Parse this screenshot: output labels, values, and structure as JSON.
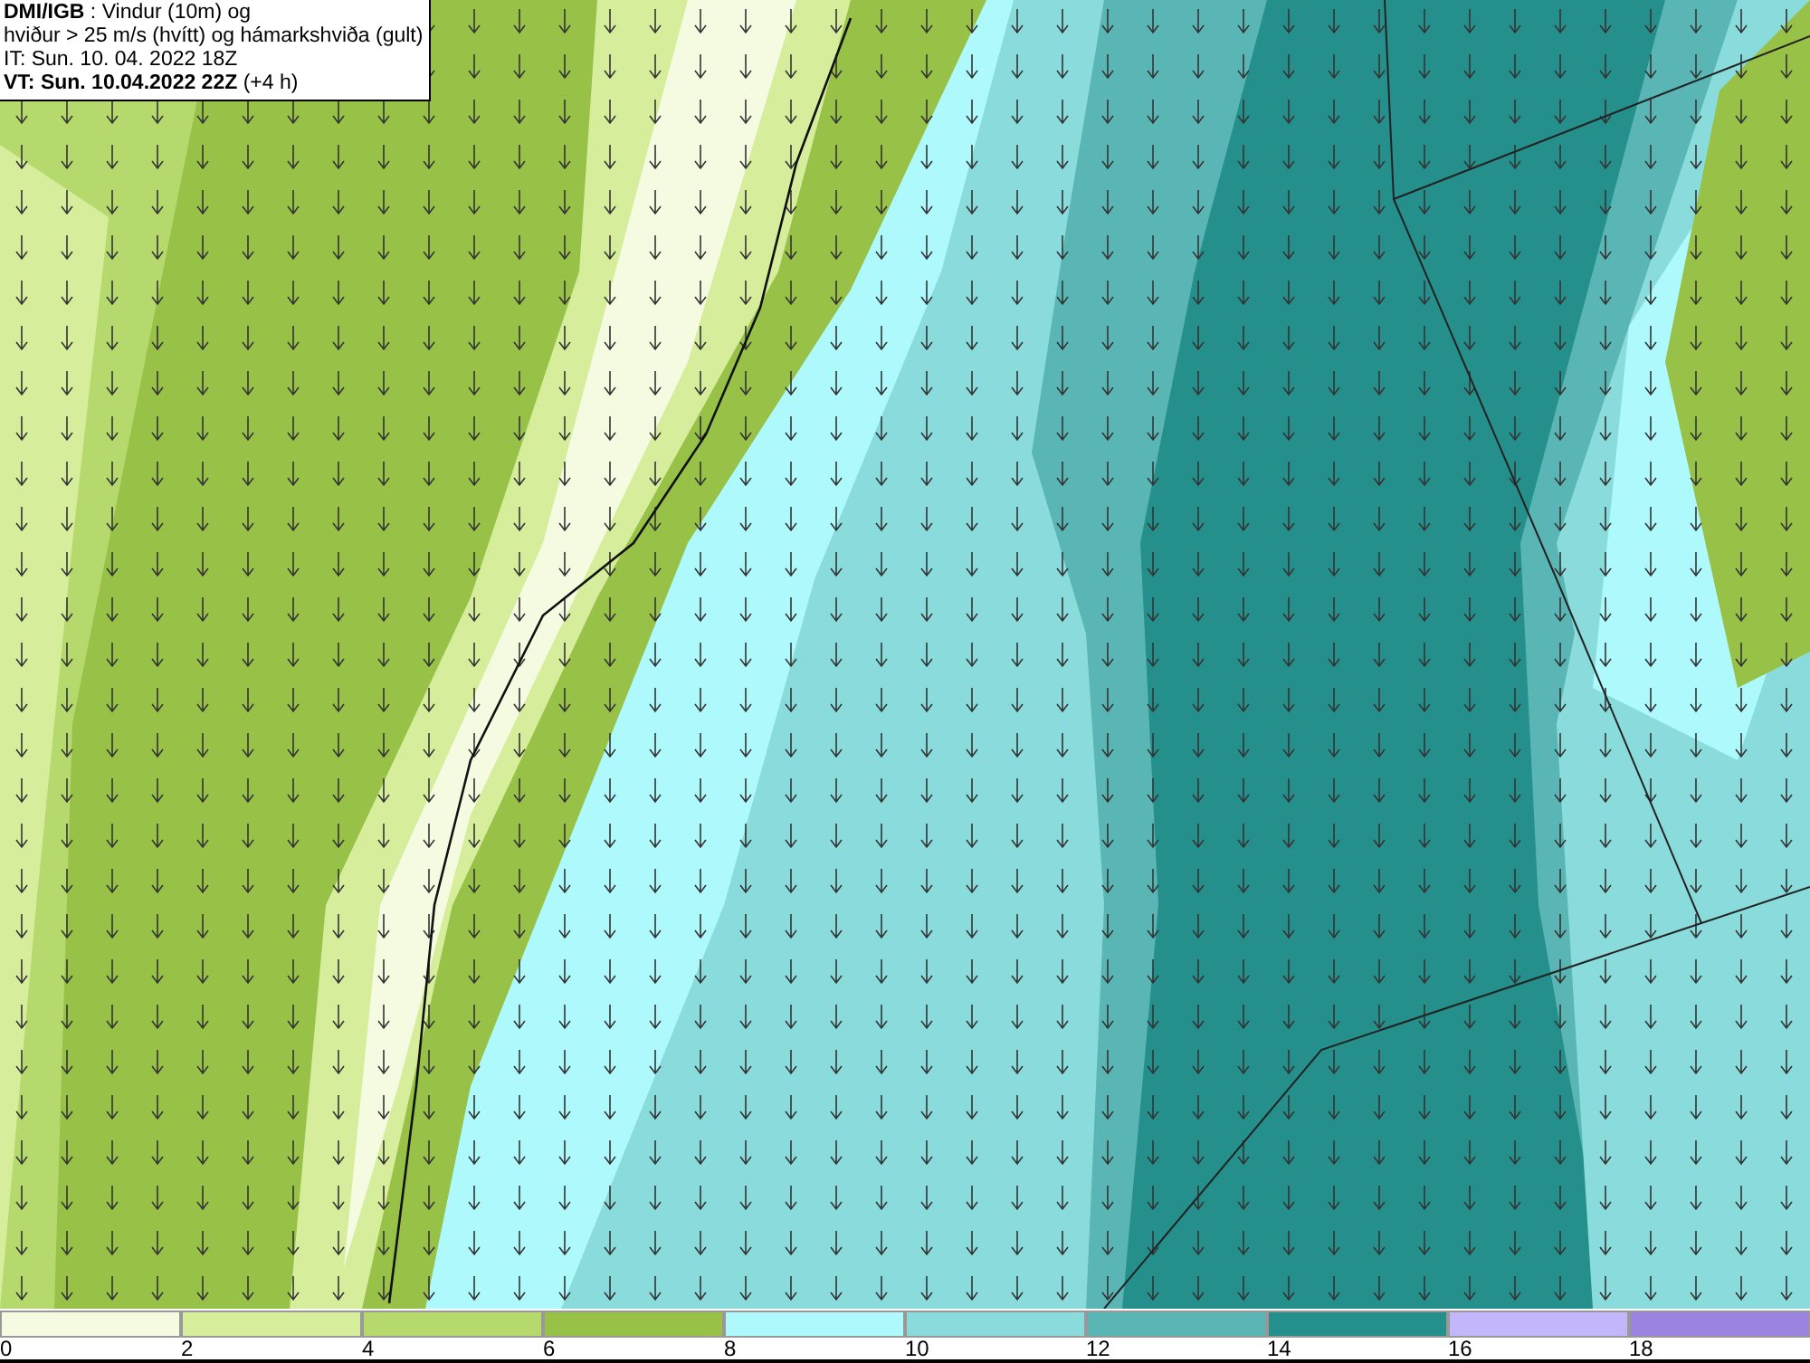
{
  "title_box": {
    "lines": [
      "**DMI/IGB** : Vindur (10m) og",
      "hviður > 25 m/s (hvítt) og hámarkshviða (gult)",
      "IT: Sun. 10. 04. 2022 18Z",
      "**VT: Sun. 10.04.2022 22Z** (+4 h)"
    ]
  },
  "legend": [
    {
      "label": "0",
      "color": "#f4fbe0"
    },
    {
      "label": "2",
      "color": "#d6ee9c"
    },
    {
      "label": "4",
      "color": "#b5d96c"
    },
    {
      "label": "6",
      "color": "#98c148"
    },
    {
      "label": "8",
      "color": "#aef9fb"
    },
    {
      "label": "10",
      "color": "#8adcdc"
    },
    {
      "label": "12",
      "color": "#5ab6b4"
    },
    {
      "label": "14",
      "color": "#258f8c"
    },
    {
      "label": "16",
      "color": "#c4b6fb"
    },
    {
      "label": "18",
      "color": "#9a84e0"
    }
  ]
}
